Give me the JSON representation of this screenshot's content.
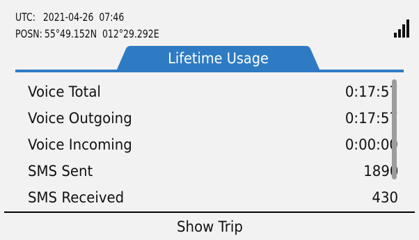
{
  "status": {
    "utc_label": "UTC:",
    "utc_value": "2021-04-26  07:46",
    "posn_label": "POSN:",
    "posn_value": "55°49.152N  012°29.292E",
    "signal_icon": "signal-strength-icon",
    "signal_bars": 4
  },
  "tab": {
    "title": "Lifetime Usage",
    "color": "#2e7bc4"
  },
  "usage": [
    {
      "label": "Voice Total",
      "value": "0:17:57"
    },
    {
      "label": "Voice Outgoing",
      "value": "0:17:57"
    },
    {
      "label": "Voice Incoming",
      "value": "0:00:00"
    },
    {
      "label": "SMS Sent",
      "value": "1890"
    },
    {
      "label": "SMS Received",
      "value": "430"
    }
  ],
  "footer": {
    "softkey_label": "Show Trip"
  }
}
